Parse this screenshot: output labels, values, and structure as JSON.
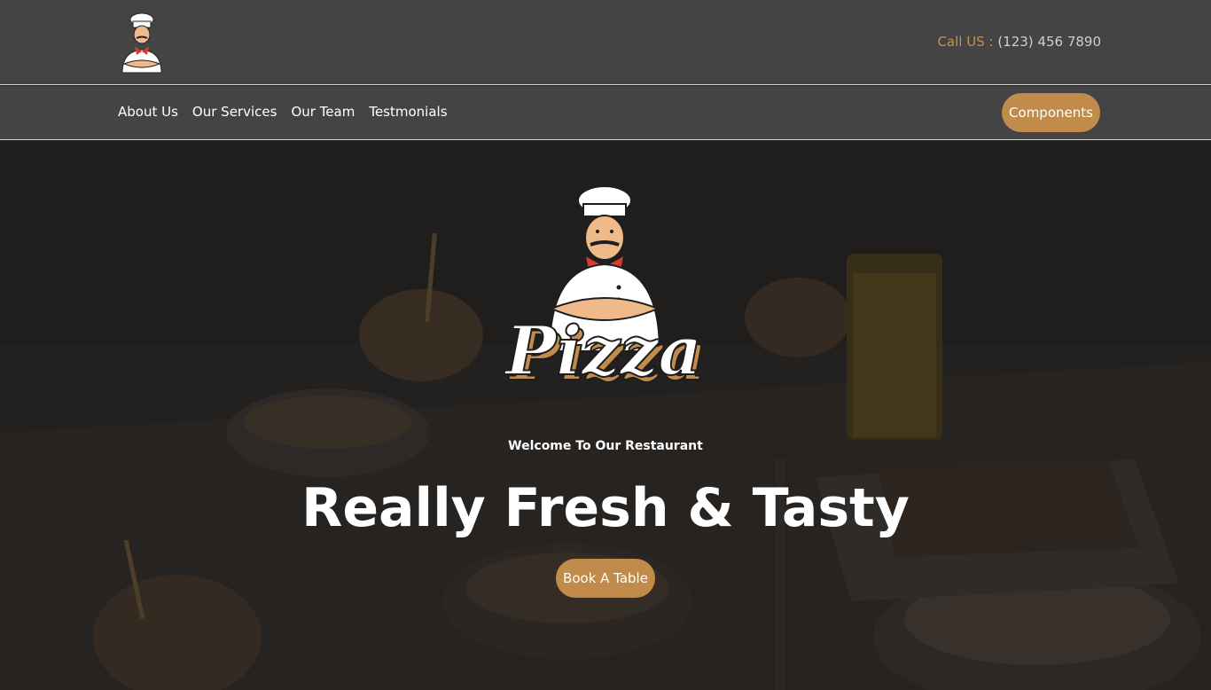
{
  "header": {
    "call_label": "Call US :",
    "phone": "(123) 456 7890"
  },
  "nav": {
    "items": [
      {
        "label": "About Us"
      },
      {
        "label": "Our Services"
      },
      {
        "label": "Our Team"
      },
      {
        "label": "Testmonials"
      }
    ],
    "components_label": "Components"
  },
  "hero": {
    "logo_text": "Pizza",
    "welcome": "Welcome To Our Restaurant",
    "headline": "Really Fresh & Tasty",
    "cta_label": "Book A Table"
  },
  "colors": {
    "topbar_bg": "#444445",
    "accent": "#c08b4b",
    "text_light": "#ffffff"
  },
  "icons": {
    "logo": "chef-logo-icon"
  }
}
